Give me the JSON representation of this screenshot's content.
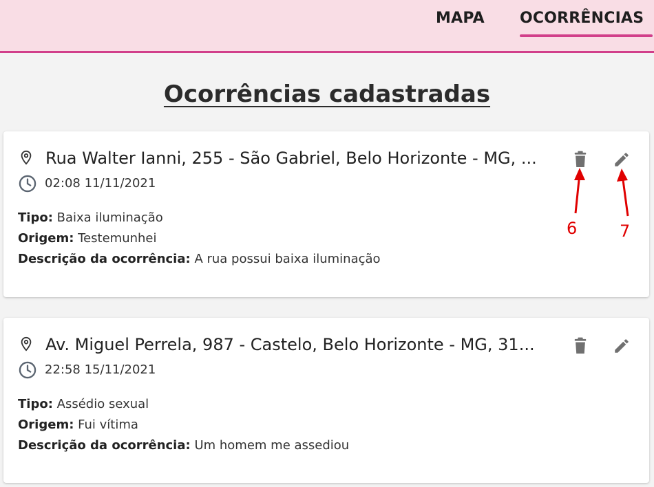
{
  "nav": {
    "items": [
      {
        "label": "MAPA",
        "active": false
      },
      {
        "label": "OCORRÊNCIAS",
        "active": true
      }
    ],
    "accent_color": "#d13f8a",
    "background_color": "#f9dde5"
  },
  "page": {
    "title": "Ocorrências cadastradas"
  },
  "labels": {
    "tipo": "Tipo:",
    "origem": "Origem:",
    "descricao": "Descrição da ocorrência:"
  },
  "occurrences": [
    {
      "address": "Rua Walter Ianni, 255 - São Gabriel, Belo Horizonte - MG, ...",
      "datetime": "02:08 11/11/2021",
      "tipo": "Baixa iluminação",
      "origem": "Testemunhei",
      "descricao": "A rua possui baixa iluminação",
      "icons": [
        "location-icon",
        "clock-icon",
        "trash-icon",
        "edit-icon"
      ]
    },
    {
      "address": "Av. Miguel Perrela, 987 - Castelo, Belo Horizonte - MG, 31...",
      "datetime": "22:58 15/11/2021",
      "tipo": "Assédio sexual",
      "origem": "Fui vítima",
      "descricao": "Um homem me assediou",
      "icons": [
        "location-icon",
        "clock-icon",
        "trash-icon",
        "edit-icon"
      ]
    }
  ],
  "annotations": [
    {
      "label": "6",
      "target": "delete-button",
      "color": "#e00000"
    },
    {
      "label": "7",
      "target": "edit-button",
      "color": "#e00000"
    }
  ]
}
